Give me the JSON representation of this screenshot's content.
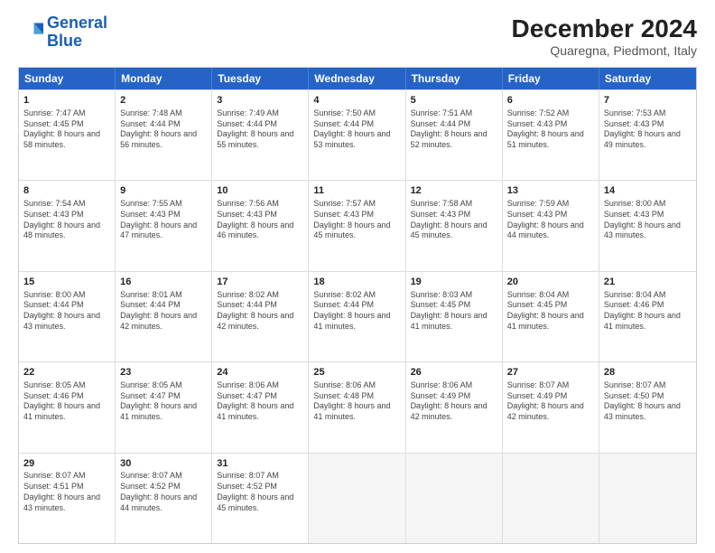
{
  "logo": {
    "line1": "General",
    "line2": "Blue"
  },
  "title": "December 2024",
  "subtitle": "Quaregna, Piedmont, Italy",
  "headers": [
    "Sunday",
    "Monday",
    "Tuesday",
    "Wednesday",
    "Thursday",
    "Friday",
    "Saturday"
  ],
  "weeks": [
    [
      {
        "day": "1",
        "sunrise": "Sunrise: 7:47 AM",
        "sunset": "Sunset: 4:45 PM",
        "daylight": "Daylight: 8 hours and 58 minutes."
      },
      {
        "day": "2",
        "sunrise": "Sunrise: 7:48 AM",
        "sunset": "Sunset: 4:44 PM",
        "daylight": "Daylight: 8 hours and 56 minutes."
      },
      {
        "day": "3",
        "sunrise": "Sunrise: 7:49 AM",
        "sunset": "Sunset: 4:44 PM",
        "daylight": "Daylight: 8 hours and 55 minutes."
      },
      {
        "day": "4",
        "sunrise": "Sunrise: 7:50 AM",
        "sunset": "Sunset: 4:44 PM",
        "daylight": "Daylight: 8 hours and 53 minutes."
      },
      {
        "day": "5",
        "sunrise": "Sunrise: 7:51 AM",
        "sunset": "Sunset: 4:44 PM",
        "daylight": "Daylight: 8 hours and 52 minutes."
      },
      {
        "day": "6",
        "sunrise": "Sunrise: 7:52 AM",
        "sunset": "Sunset: 4:43 PM",
        "daylight": "Daylight: 8 hours and 51 minutes."
      },
      {
        "day": "7",
        "sunrise": "Sunrise: 7:53 AM",
        "sunset": "Sunset: 4:43 PM",
        "daylight": "Daylight: 8 hours and 49 minutes."
      }
    ],
    [
      {
        "day": "8",
        "sunrise": "Sunrise: 7:54 AM",
        "sunset": "Sunset: 4:43 PM",
        "daylight": "Daylight: 8 hours and 48 minutes."
      },
      {
        "day": "9",
        "sunrise": "Sunrise: 7:55 AM",
        "sunset": "Sunset: 4:43 PM",
        "daylight": "Daylight: 8 hours and 47 minutes."
      },
      {
        "day": "10",
        "sunrise": "Sunrise: 7:56 AM",
        "sunset": "Sunset: 4:43 PM",
        "daylight": "Daylight: 8 hours and 46 minutes."
      },
      {
        "day": "11",
        "sunrise": "Sunrise: 7:57 AM",
        "sunset": "Sunset: 4:43 PM",
        "daylight": "Daylight: 8 hours and 45 minutes."
      },
      {
        "day": "12",
        "sunrise": "Sunrise: 7:58 AM",
        "sunset": "Sunset: 4:43 PM",
        "daylight": "Daylight: 8 hours and 45 minutes."
      },
      {
        "day": "13",
        "sunrise": "Sunrise: 7:59 AM",
        "sunset": "Sunset: 4:43 PM",
        "daylight": "Daylight: 8 hours and 44 minutes."
      },
      {
        "day": "14",
        "sunrise": "Sunrise: 8:00 AM",
        "sunset": "Sunset: 4:43 PM",
        "daylight": "Daylight: 8 hours and 43 minutes."
      }
    ],
    [
      {
        "day": "15",
        "sunrise": "Sunrise: 8:00 AM",
        "sunset": "Sunset: 4:44 PM",
        "daylight": "Daylight: 8 hours and 43 minutes."
      },
      {
        "day": "16",
        "sunrise": "Sunrise: 8:01 AM",
        "sunset": "Sunset: 4:44 PM",
        "daylight": "Daylight: 8 hours and 42 minutes."
      },
      {
        "day": "17",
        "sunrise": "Sunrise: 8:02 AM",
        "sunset": "Sunset: 4:44 PM",
        "daylight": "Daylight: 8 hours and 42 minutes."
      },
      {
        "day": "18",
        "sunrise": "Sunrise: 8:02 AM",
        "sunset": "Sunset: 4:44 PM",
        "daylight": "Daylight: 8 hours and 41 minutes."
      },
      {
        "day": "19",
        "sunrise": "Sunrise: 8:03 AM",
        "sunset": "Sunset: 4:45 PM",
        "daylight": "Daylight: 8 hours and 41 minutes."
      },
      {
        "day": "20",
        "sunrise": "Sunrise: 8:04 AM",
        "sunset": "Sunset: 4:45 PM",
        "daylight": "Daylight: 8 hours and 41 minutes."
      },
      {
        "day": "21",
        "sunrise": "Sunrise: 8:04 AM",
        "sunset": "Sunset: 4:46 PM",
        "daylight": "Daylight: 8 hours and 41 minutes."
      }
    ],
    [
      {
        "day": "22",
        "sunrise": "Sunrise: 8:05 AM",
        "sunset": "Sunset: 4:46 PM",
        "daylight": "Daylight: 8 hours and 41 minutes."
      },
      {
        "day": "23",
        "sunrise": "Sunrise: 8:05 AM",
        "sunset": "Sunset: 4:47 PM",
        "daylight": "Daylight: 8 hours and 41 minutes."
      },
      {
        "day": "24",
        "sunrise": "Sunrise: 8:06 AM",
        "sunset": "Sunset: 4:47 PM",
        "daylight": "Daylight: 8 hours and 41 minutes."
      },
      {
        "day": "25",
        "sunrise": "Sunrise: 8:06 AM",
        "sunset": "Sunset: 4:48 PM",
        "daylight": "Daylight: 8 hours and 41 minutes."
      },
      {
        "day": "26",
        "sunrise": "Sunrise: 8:06 AM",
        "sunset": "Sunset: 4:49 PM",
        "daylight": "Daylight: 8 hours and 42 minutes."
      },
      {
        "day": "27",
        "sunrise": "Sunrise: 8:07 AM",
        "sunset": "Sunset: 4:49 PM",
        "daylight": "Daylight: 8 hours and 42 minutes."
      },
      {
        "day": "28",
        "sunrise": "Sunrise: 8:07 AM",
        "sunset": "Sunset: 4:50 PM",
        "daylight": "Daylight: 8 hours and 43 minutes."
      }
    ],
    [
      {
        "day": "29",
        "sunrise": "Sunrise: 8:07 AM",
        "sunset": "Sunset: 4:51 PM",
        "daylight": "Daylight: 8 hours and 43 minutes."
      },
      {
        "day": "30",
        "sunrise": "Sunrise: 8:07 AM",
        "sunset": "Sunset: 4:52 PM",
        "daylight": "Daylight: 8 hours and 44 minutes."
      },
      {
        "day": "31",
        "sunrise": "Sunrise: 8:07 AM",
        "sunset": "Sunset: 4:52 PM",
        "daylight": "Daylight: 8 hours and 45 minutes."
      },
      null,
      null,
      null,
      null
    ]
  ]
}
